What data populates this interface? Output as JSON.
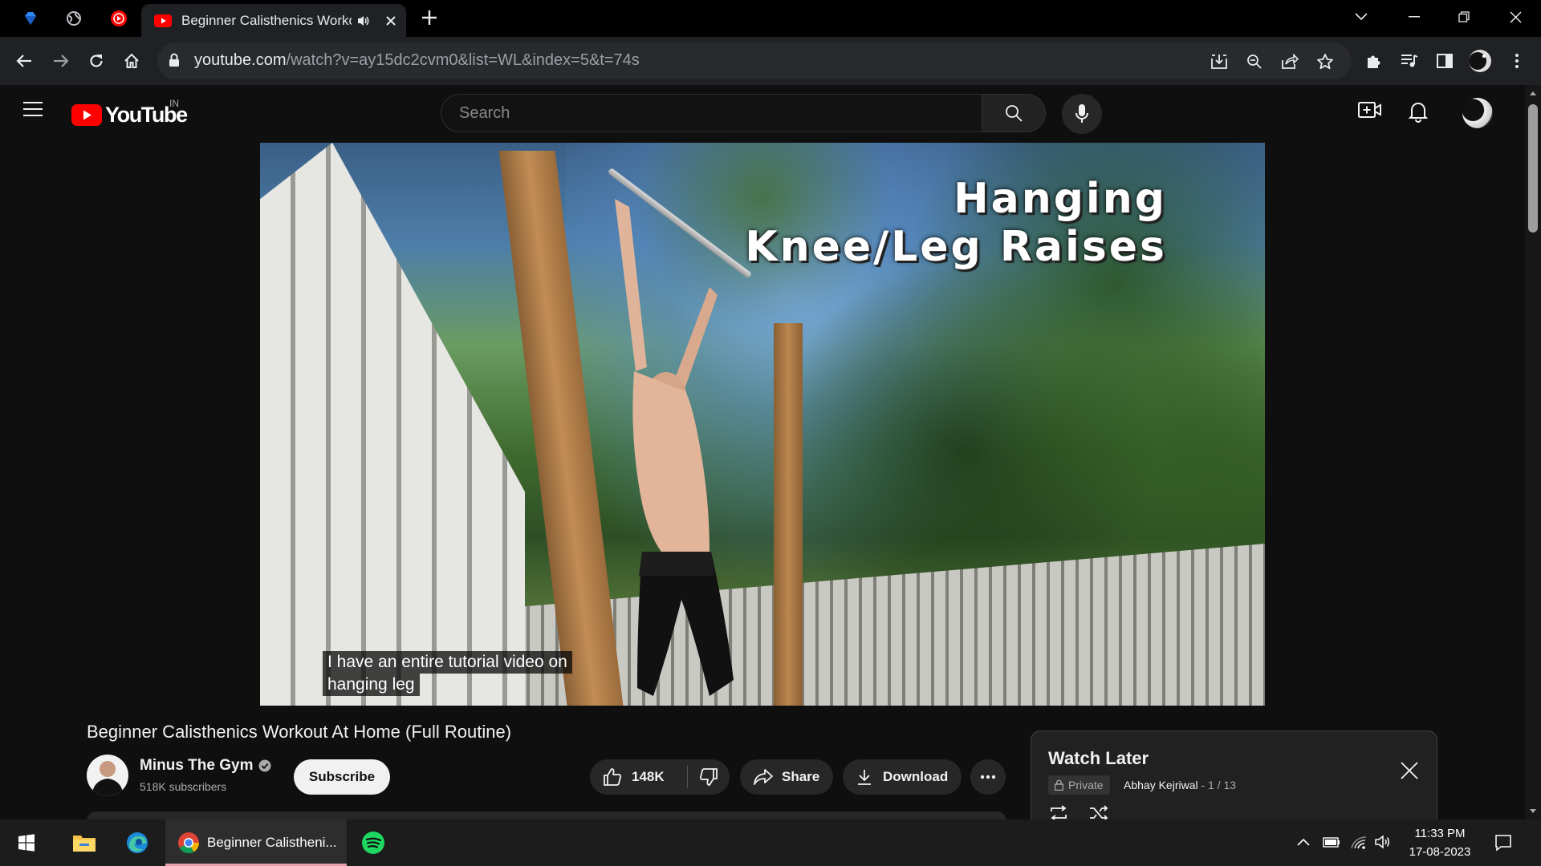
{
  "browser": {
    "tab_title": "Beginner Calisthenics Worko",
    "url_host": "youtube.com",
    "url_path": "/watch?v=ay15dc2cvm0&list=WL&index=5&t=74s"
  },
  "youtube": {
    "logo_text": "YouTube",
    "region": "IN",
    "search_placeholder": "Search"
  },
  "video": {
    "overlay_line1": "Hanging",
    "overlay_line2": "Knee/Leg Raises",
    "caption_line1": "I have an entire tutorial video on",
    "caption_line2": "hanging leg",
    "title": "Beginner Calisthenics Workout At Home (Full Routine)"
  },
  "channel": {
    "name": "Minus The Gym",
    "subscribers": "518K subscribers",
    "subscribe_label": "Subscribe"
  },
  "actions": {
    "likes": "148K",
    "share_label": "Share",
    "download_label": "Download"
  },
  "watch_later": {
    "title": "Watch Later",
    "privacy": "Private",
    "owner": "Abhay Kejriwal",
    "position": " - 1 / 13"
  },
  "taskbar": {
    "chrome_label": "Beginner Calistheni...",
    "time": "11:33 PM",
    "date": "17-08-2023"
  },
  "colors": {
    "youtube_red": "#ff0000",
    "page_bg": "#0f0f0f",
    "chrome_toolbar": "#202124"
  }
}
